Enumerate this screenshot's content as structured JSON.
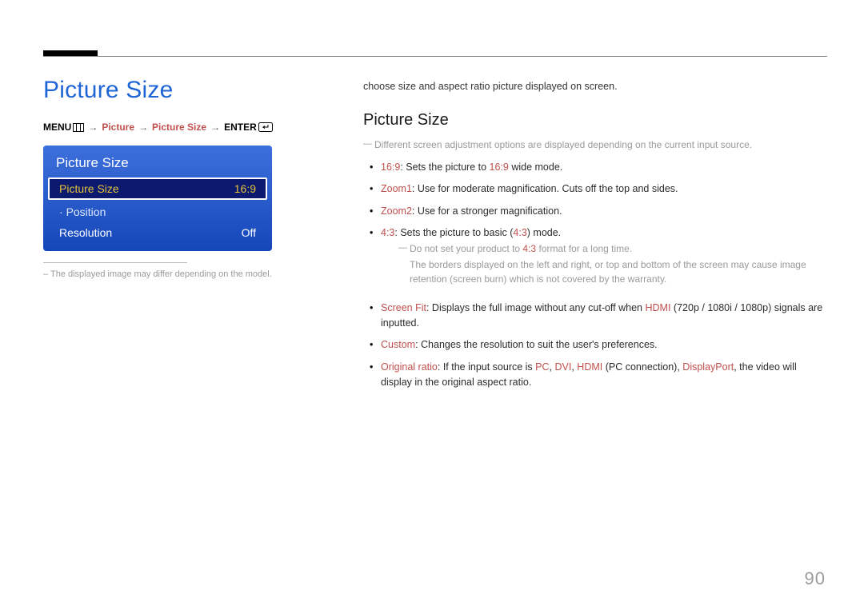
{
  "page_number": "90",
  "title": "Picture Size",
  "breadcrumb": {
    "menu": "MENU",
    "picture": "Picture",
    "picture_size": "Picture Size",
    "enter": "ENTER"
  },
  "osd": {
    "panel_title": "Picture Size",
    "rows": [
      {
        "label": "Picture Size",
        "value": "16:9",
        "kind": "selected"
      },
      {
        "label": "Position",
        "value": "",
        "kind": "sub"
      },
      {
        "label": "Resolution",
        "value": "Off",
        "kind": "normal"
      }
    ]
  },
  "footnote": "The displayed image may differ depending on the model.",
  "lead": "choose size and aspect ratio picture displayed on screen.",
  "section_heading": "Picture Size",
  "section_note": "Different screen adjustment options are displayed depending on the current input source.",
  "items": {
    "i169_label": "16:9",
    "i169_text_a": ": Sets the picture to ",
    "i169_val": "16:9",
    "i169_text_b": " wide mode.",
    "zoom1_label": "Zoom1",
    "zoom1_text": ": Use for moderate magnification. Cuts off the top and sides.",
    "zoom2_label": "Zoom2",
    "zoom2_text": ": Use for a stronger magnification.",
    "i43_label": "4:3",
    "i43_text_a": ": Sets the picture to basic (",
    "i43_val": "4:3",
    "i43_text_b": ") mode.",
    "i43_note_a": "Do not set your product to ",
    "i43_note_val": "4:3",
    "i43_note_b": " format for a long time.",
    "i43_note_body": "The borders displayed on the left and right, or top and bottom of the screen may cause image retention (screen burn) which is not covered by the warranty.",
    "fit_label": "Screen Fit",
    "fit_text_a": ": Displays the full image without any cut-off when ",
    "fit_hdmi": "HDMI",
    "fit_text_b": " (720p / 1080i / 1080p) signals are inputted.",
    "custom_label": "Custom",
    "custom_text": ": Changes the resolution to suit the user's preferences.",
    "orig_label": "Original ratio",
    "orig_text_a": ": If the input source is ",
    "orig_pc": "PC",
    "orig_sep1": ", ",
    "orig_dvi": "DVI",
    "orig_sep2": ", ",
    "orig_hdmi": "HDMI",
    "orig_text_b": " (PC connection), ",
    "orig_dp": "DisplayPort",
    "orig_text_c": ", the video will display in the original aspect ratio."
  }
}
